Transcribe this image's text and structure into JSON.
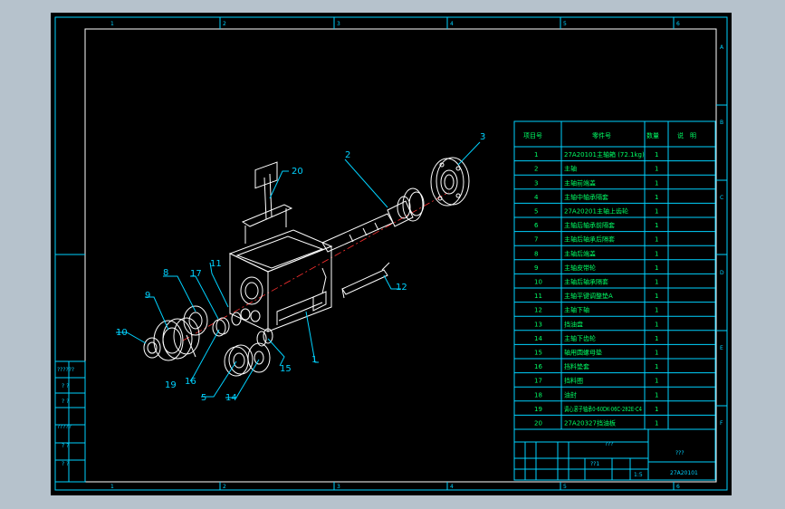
{
  "drawing": {
    "bom_headers": [
      "项目号",
      "零件号",
      "数量",
      "说　明"
    ],
    "bom_rows": [
      {
        "no": "1",
        "part": "27A20101主轴箱 (72.1kg)",
        "qty": "1",
        "note": ""
      },
      {
        "no": "2",
        "part": "主轴",
        "qty": "1",
        "note": ""
      },
      {
        "no": "3",
        "part": "主轴前端盖",
        "qty": "1",
        "note": ""
      },
      {
        "no": "4",
        "part": "主轴中轴承隔套",
        "qty": "1",
        "note": ""
      },
      {
        "no": "5",
        "part": "27A20201主轴上齿轮",
        "qty": "1",
        "note": ""
      },
      {
        "no": "6",
        "part": "主轴后轴承前隔套",
        "qty": "1",
        "note": ""
      },
      {
        "no": "7",
        "part": "主轴后轴承后隔套",
        "qty": "1",
        "note": ""
      },
      {
        "no": "8",
        "part": "主轴后端盖",
        "qty": "1",
        "note": ""
      },
      {
        "no": "9",
        "part": "主轴皮带轮",
        "qty": "1",
        "note": ""
      },
      {
        "no": "10",
        "part": "主轴后轴承隔套",
        "qty": "1",
        "note": ""
      },
      {
        "no": "11",
        "part": "主轴平键调整垫A",
        "qty": "1",
        "note": ""
      },
      {
        "no": "12",
        "part": "主轴下轴",
        "qty": "1",
        "note": ""
      },
      {
        "no": "13",
        "part": "挡油盘",
        "qty": "1",
        "note": ""
      },
      {
        "no": "14",
        "part": "主轴下齿轮",
        "qty": "1",
        "note": ""
      },
      {
        "no": "15",
        "part": "轴用圆螺母垫",
        "qty": "1",
        "note": ""
      },
      {
        "no": "16",
        "part": "挡料垫套",
        "qty": "1",
        "note": ""
      },
      {
        "no": "17",
        "part": "挡料圈",
        "qty": "1",
        "note": ""
      },
      {
        "no": "18",
        "part": "油封",
        "qty": "1",
        "note": ""
      },
      {
        "no": "19",
        "part": "调心滚子轴承0-60DK-06C-282E-C4",
        "qty": "1",
        "note": ""
      },
      {
        "no": "20",
        "part": "27A20327挡油板",
        "qty": "1",
        "note": ""
      }
    ],
    "callouts": [
      "1",
      "2",
      "3",
      "5",
      "8",
      "9",
      "10",
      "11",
      "12",
      "14",
      "15",
      "16",
      "17",
      "19",
      "20"
    ],
    "title_block": {
      "center_text": "???",
      "company": "???",
      "drawing_no": "27A20101",
      "sheet": "??1",
      "scale": "1:5"
    },
    "left_block": [
      "??????",
      "? ?",
      "? ?",
      "?????",
      "? ?",
      "? ?"
    ],
    "border_numbers_top": [
      "1",
      "2",
      "3",
      "4",
      "5",
      "6"
    ],
    "border_numbers_bottom": [
      "1",
      "2",
      "3",
      "4",
      "5",
      "6"
    ],
    "border_letters_right": [
      "A",
      "B",
      "C",
      "D",
      "E",
      "F"
    ]
  }
}
